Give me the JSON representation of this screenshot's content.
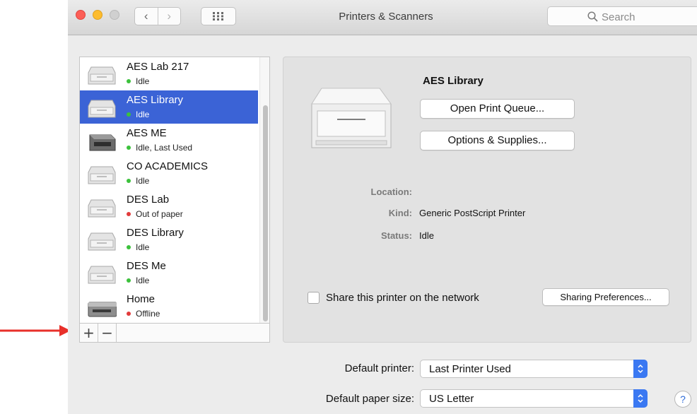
{
  "window": {
    "title": "Printers & Scanners"
  },
  "toolbar": {
    "back_glyph": "‹",
    "forward_glyph": "›",
    "grid_icon": "grid-view-icon"
  },
  "search": {
    "placeholder": "Search",
    "icon": "search-icon"
  },
  "printers": [
    {
      "name": "AES Lab 217",
      "status": "Idle",
      "status_color": "#3cc13c",
      "selected": false
    },
    {
      "name": "AES Library",
      "status": "Idle",
      "status_color": "#3cc13c",
      "selected": true
    },
    {
      "name": "AES ME",
      "status": "Idle, Last Used",
      "status_color": "#3cc13c",
      "selected": false
    },
    {
      "name": "CO ACADEMICS",
      "status": "Idle",
      "status_color": "#3cc13c",
      "selected": false
    },
    {
      "name": "DES Lab",
      "status": "Out of paper",
      "status_color": "#e23b3b",
      "selected": false
    },
    {
      "name": "DES Library",
      "status": "Idle",
      "status_color": "#3cc13c",
      "selected": false
    },
    {
      "name": "DES Me",
      "status": "Idle",
      "status_color": "#3cc13c",
      "selected": false
    },
    {
      "name": "Home",
      "status": "Offline",
      "status_color": "#e23b3b",
      "selected": false
    }
  ],
  "list_controls": {
    "add_label": "+",
    "remove_label": "−"
  },
  "detail": {
    "printer_name": "AES Library",
    "open_queue_label": "Open Print Queue...",
    "options_label": "Options & Supplies...",
    "location_label": "Location:",
    "location_value": "",
    "kind_label": "Kind:",
    "kind_value": "Generic PostScript Printer",
    "status_label": "Status:",
    "status_value": "Idle",
    "share_label": "Share this printer on the network",
    "share_checked": false,
    "sharing_prefs_label": "Sharing Preferences..."
  },
  "defaults": {
    "default_printer_label": "Default printer:",
    "default_printer_value": "Last Printer Used",
    "paper_size_label": "Default paper size:",
    "paper_size_value": "US Letter"
  },
  "help": {
    "label": "?"
  },
  "colors": {
    "selection": "#3b63d6",
    "stepper": "#3a78f2",
    "annotation_arrow": "#e8302a"
  }
}
